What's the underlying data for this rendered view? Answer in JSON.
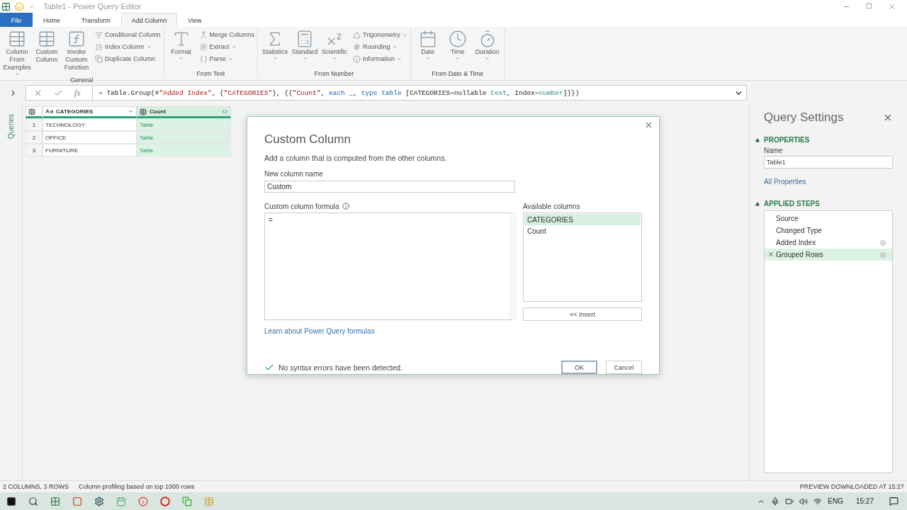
{
  "window": {
    "title": "Table1 - Power Query Editor"
  },
  "ribbon_tabs": [
    {
      "label": "File",
      "selected": false,
      "kind": "file"
    },
    {
      "label": "Home",
      "selected": false,
      "kind": "tab"
    },
    {
      "label": "Transform",
      "selected": false,
      "kind": "tab"
    },
    {
      "label": "Add Column",
      "selected": true,
      "kind": "tab"
    },
    {
      "label": "View",
      "selected": false,
      "kind": "tab"
    }
  ],
  "ribbon_groups": [
    {
      "label": "General",
      "items": [
        {
          "label": "Column From Examples",
          "kind": "large",
          "dropdown": true
        },
        {
          "label": "Custom Column",
          "kind": "large",
          "dropdown": false
        },
        {
          "label": "Invoke Custom Function",
          "kind": "large",
          "dropdown": false
        },
        {
          "label": "Conditional Column",
          "kind": "small",
          "dropdown": false
        },
        {
          "label": "Index Column",
          "kind": "small",
          "dropdown": true
        },
        {
          "label": "Duplicate Column",
          "kind": "small",
          "dropdown": false
        }
      ]
    },
    {
      "label": "From Text",
      "items": [
        {
          "label": "Format",
          "kind": "large",
          "dropdown": true
        },
        {
          "label": "Merge Columns",
          "kind": "small",
          "dropdown": false
        },
        {
          "label": "Extract",
          "kind": "small",
          "dropdown": true
        },
        {
          "label": "Parse",
          "kind": "small",
          "dropdown": true
        }
      ]
    },
    {
      "label": "From Number",
      "items": [
        {
          "label": "Statistics",
          "kind": "large",
          "dropdown": true
        },
        {
          "label": "Standard",
          "kind": "large",
          "dropdown": true
        },
        {
          "label": "Scientific",
          "kind": "large",
          "dropdown": true
        },
        {
          "label": "Trigonometry",
          "kind": "small",
          "dropdown": true
        },
        {
          "label": "Rounding",
          "kind": "small",
          "dropdown": true
        },
        {
          "label": "Information",
          "kind": "small",
          "dropdown": true
        }
      ]
    },
    {
      "label": "From Date & Time",
      "items": [
        {
          "label": "Date",
          "kind": "large",
          "dropdown": true
        },
        {
          "label": "Time",
          "kind": "large",
          "dropdown": true
        },
        {
          "label": "Duration",
          "kind": "large",
          "dropdown": true
        }
      ]
    }
  ],
  "formula_bar": {
    "fx": "fx",
    "formula": [
      {
        "text": "= Table.Group(#",
        "kind": "plain"
      },
      {
        "text": "\"Added Index\"",
        "kind": "string"
      },
      {
        "text": ", {",
        "kind": "plain"
      },
      {
        "text": "\"CATEGORIES\"",
        "kind": "string"
      },
      {
        "text": "}, {{",
        "kind": "plain"
      },
      {
        "text": "\"Count\"",
        "kind": "string"
      },
      {
        "text": ", ",
        "kind": "plain"
      },
      {
        "text": "each",
        "kind": "keyword"
      },
      {
        "text": " _, ",
        "kind": "plain"
      },
      {
        "text": "type table",
        "kind": "keyword"
      },
      {
        "text": " [CATEGORIES=nullable ",
        "kind": "plain"
      },
      {
        "text": "text",
        "kind": "type"
      },
      {
        "text": ", Index=",
        "kind": "plain"
      },
      {
        "text": "number",
        "kind": "type"
      },
      {
        "text": "]}})",
        "kind": "plain"
      }
    ]
  },
  "queries_pane": {
    "label": "Queries"
  },
  "table": {
    "columns": [
      {
        "name": "CATEGORIES",
        "kind": "text",
        "selected": false
      },
      {
        "name": "Count",
        "kind": "table",
        "selected": true
      }
    ],
    "rows": [
      {
        "index": "1",
        "cells": [
          "TECHNOLOGY",
          "Table"
        ]
      },
      {
        "index": "2",
        "cells": [
          "OFFICE",
          "Table"
        ]
      },
      {
        "index": "3",
        "cells": [
          "FURNITURE",
          "Table"
        ]
      }
    ]
  },
  "dialog": {
    "title": "Custom Column",
    "description": "Add a column that is computed from the other columns.",
    "name_label": "New column name",
    "name_value": "Custom",
    "formula_label": "Custom column formula",
    "formula_value": "=",
    "available_label": "Available columns",
    "available_columns": [
      {
        "name": "CATEGORIES",
        "selected": true
      },
      {
        "name": "Count",
        "selected": false
      }
    ],
    "insert_button": "<< Insert",
    "learn_link": "Learn about Power Query formulas",
    "status": "No syntax errors have been detected.",
    "ok_button": "OK",
    "cancel_button": "Cancel"
  },
  "query_settings": {
    "title": "Query Settings",
    "properties_heading": "PROPERTIES",
    "name_label": "Name",
    "name_value": "Table1",
    "all_properties_link": "All Properties",
    "steps_heading": "APPLIED STEPS",
    "steps": [
      {
        "label": "Source",
        "selected": false,
        "settings": false
      },
      {
        "label": "Changed Type",
        "selected": false,
        "settings": false
      },
      {
        "label": "Added Index",
        "selected": false,
        "settings": true
      },
      {
        "label": "Grouped Rows",
        "selected": true,
        "settings": true
      }
    ]
  },
  "status_bar": {
    "counts": "2 COLUMNS, 3 ROWS",
    "profiling": "Column profiling based on top 1000 rows",
    "preview": "PREVIEW DOWNLOADED AT 15:27"
  },
  "taskbar": {
    "language": "ENG",
    "time": "15:27"
  }
}
